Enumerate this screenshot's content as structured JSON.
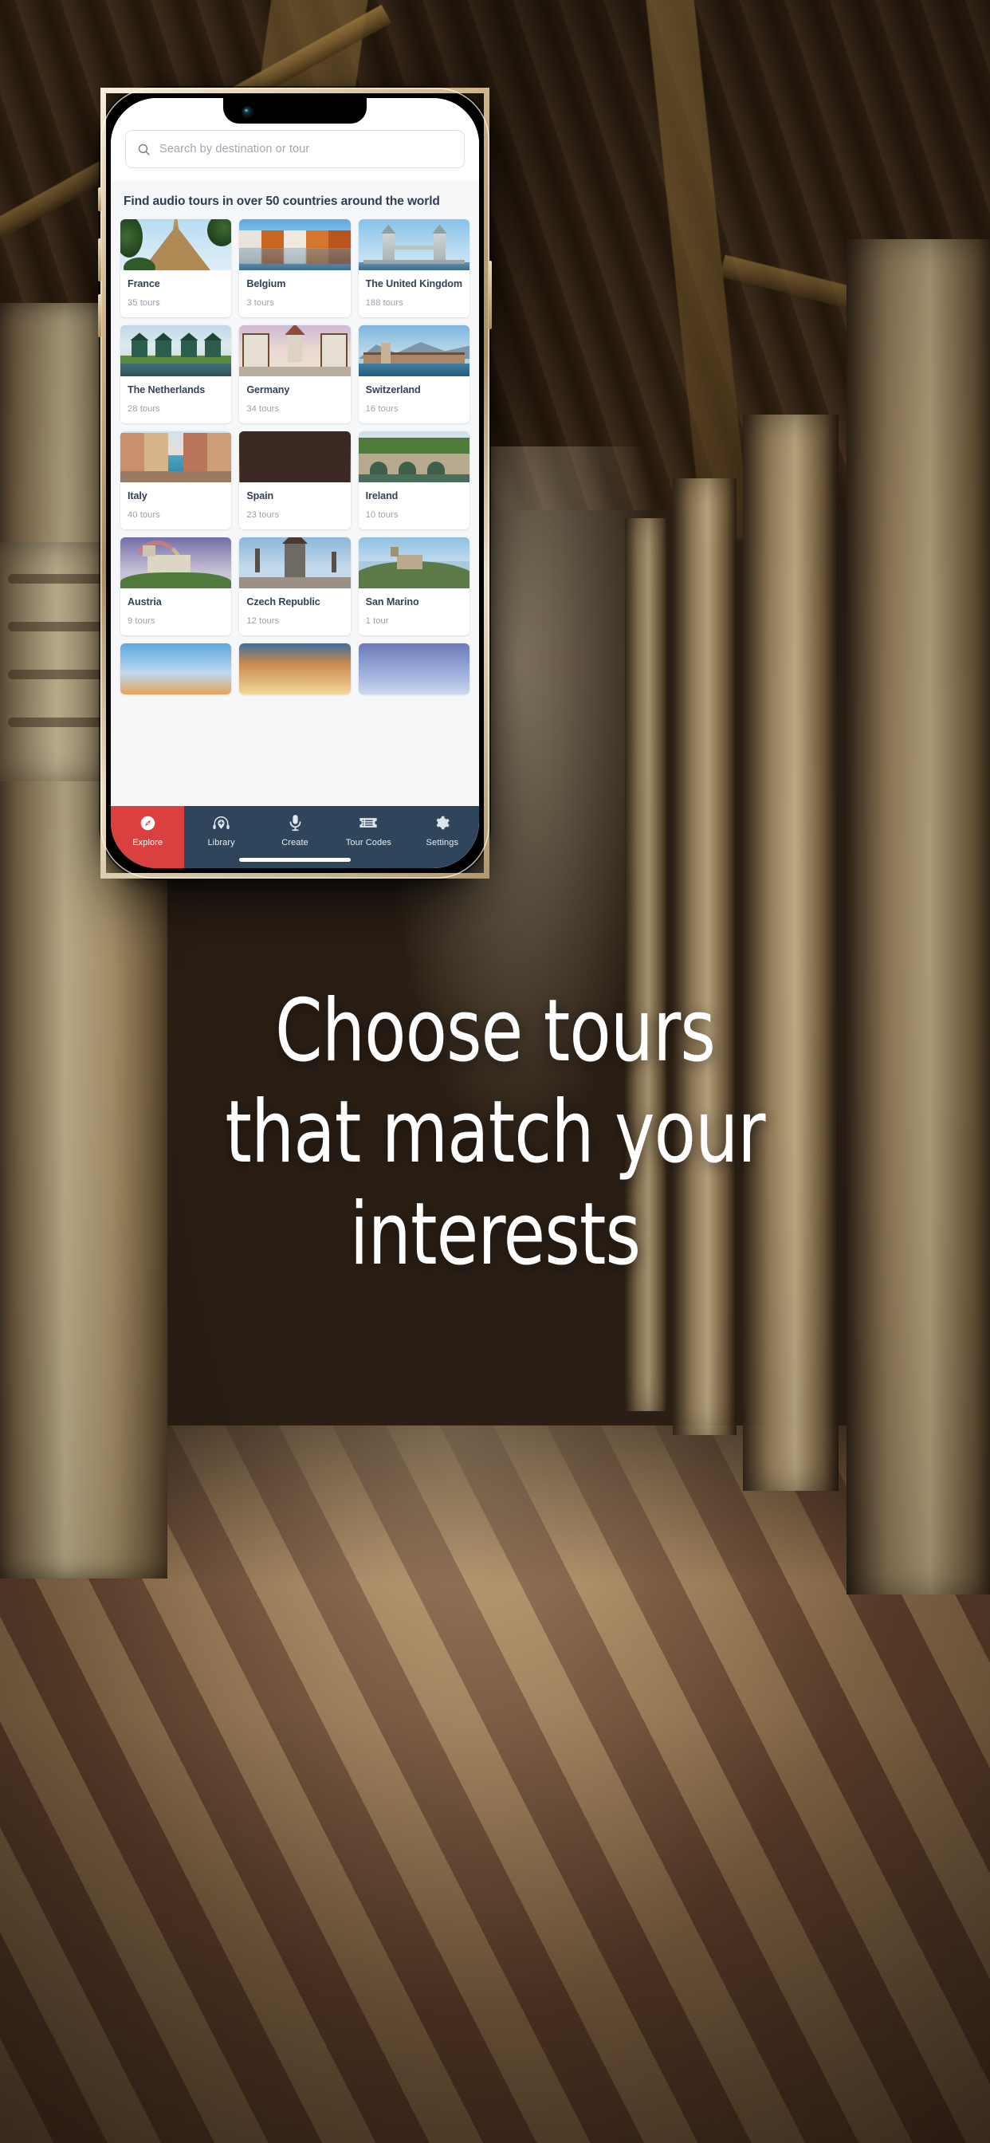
{
  "caption": {
    "lines": [
      "Choose tours",
      "that match your",
      "interests"
    ]
  },
  "colors": {
    "accent": "#d9403f",
    "tabbar": "#2f455c",
    "heading_text": "#2e3d52",
    "muted_text": "#9aa1ac",
    "card_bg": "#ffffff",
    "app_bg": "#f6f7f9"
  },
  "app": {
    "search": {
      "icon": "search-icon",
      "placeholder": "Search by destination or tour",
      "value": ""
    },
    "heading": "Find audio tours in over 50 countries around the world",
    "countries": [
      {
        "name": "France",
        "tours": "35 tours",
        "image": "eiffel-tower-photo"
      },
      {
        "name": "Belgium",
        "tours": "3 tours",
        "image": "bruges-canal-photo"
      },
      {
        "name": "The United Kingdom",
        "tours": "188 tours",
        "image": "tower-bridge-photo"
      },
      {
        "name": "The Netherlands",
        "tours": "28 tours",
        "image": "zaanse-schans-photo"
      },
      {
        "name": "Germany",
        "tours": "34 tours",
        "image": "half-timbered-street-photo"
      },
      {
        "name": "Switzerland",
        "tours": "16 tours",
        "image": "lucerne-chapel-bridge-photo"
      },
      {
        "name": "Italy",
        "tours": "40 tours",
        "image": "venice-canal-photo"
      },
      {
        "name": "Spain",
        "tours": "23 tours",
        "image": "sunset-arch-photo"
      },
      {
        "name": "Ireland",
        "tours": "10 tours",
        "image": "stone-bridge-photo"
      },
      {
        "name": "Austria",
        "tours": "9 tours",
        "image": "castle-rainbow-photo"
      },
      {
        "name": "Czech Republic",
        "tours": "12 tours",
        "image": "charles-bridge-photo"
      },
      {
        "name": "San Marino",
        "tours": "1 tour",
        "image": "hilltop-fortress-photo"
      }
    ],
    "tabs": [
      {
        "label": "Explore",
        "icon": "compass-icon",
        "active": true
      },
      {
        "label": "Library",
        "icon": "headphones-pin-icon",
        "active": false
      },
      {
        "label": "Create",
        "icon": "microphone-icon",
        "active": false
      },
      {
        "label": "Tour Codes",
        "icon": "ticket-list-icon",
        "active": false
      },
      {
        "label": "Settings",
        "icon": "gear-icon",
        "active": false
      }
    ]
  }
}
